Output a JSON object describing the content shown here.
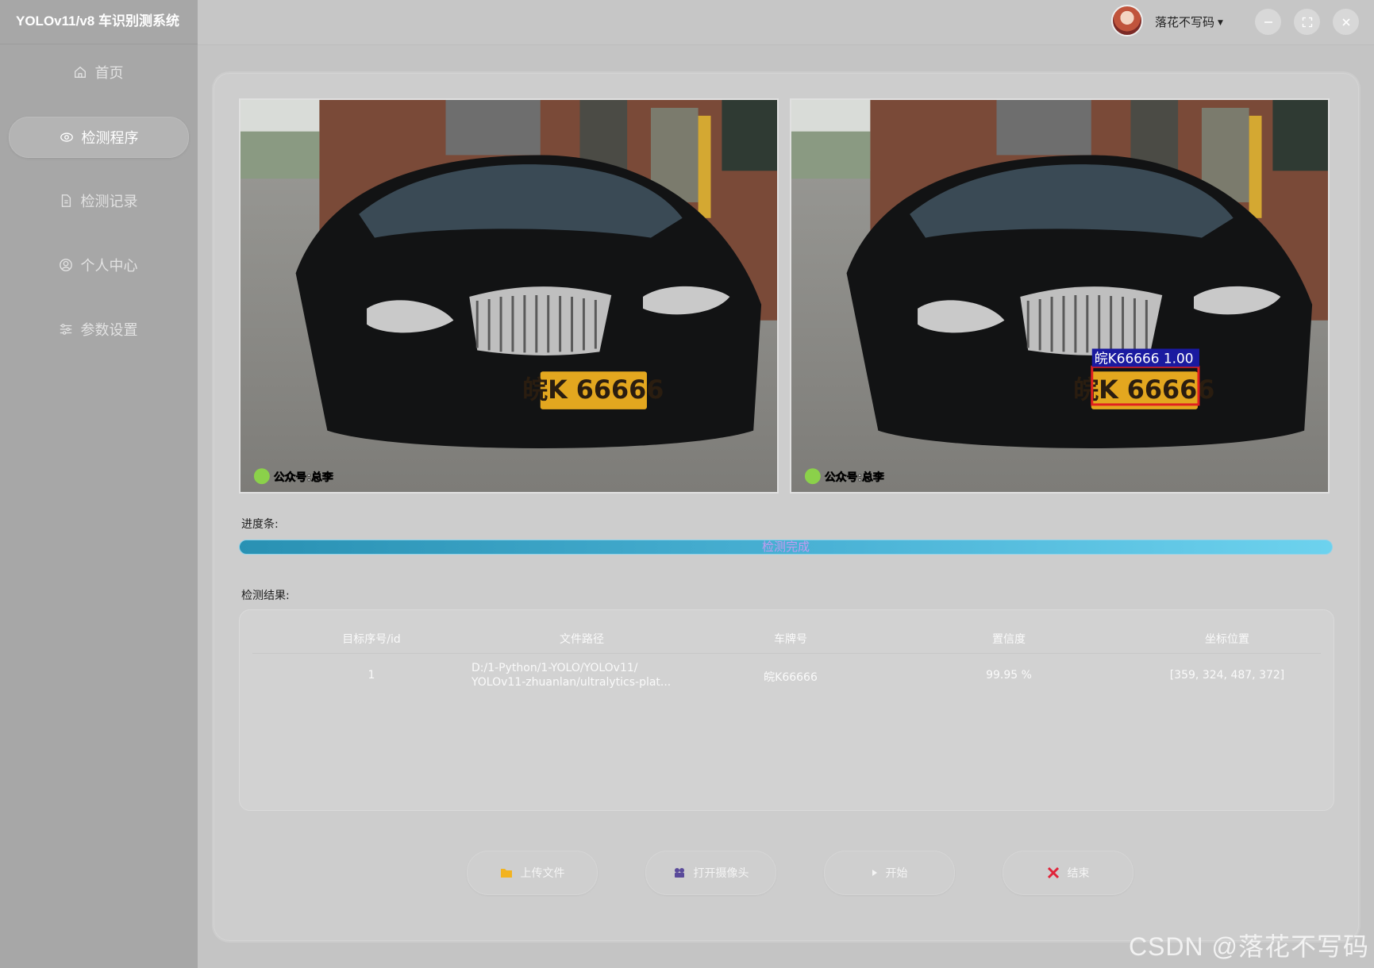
{
  "app": {
    "title": "YOLOv11/v8 车识别测系统"
  },
  "sidebar": {
    "items": [
      {
        "label": "首页",
        "icon": "home-icon",
        "active": false
      },
      {
        "label": "检测程序",
        "icon": "eye-icon",
        "active": true
      },
      {
        "label": "检测记录",
        "icon": "document-icon",
        "active": false
      },
      {
        "label": "个人中心",
        "icon": "user-icon",
        "active": false
      },
      {
        "label": "参数设置",
        "icon": "sliders-icon",
        "active": false
      }
    ]
  },
  "header": {
    "username": "落花不写码",
    "dropdown_icon": "caret-down-icon",
    "window_controls": [
      "minimize-icon",
      "maximize-icon",
      "close-icon"
    ]
  },
  "images": {
    "original": {
      "overlay_text": "公众号:总李"
    },
    "result": {
      "overlay_text": "公众号:总李",
      "detection_label": "皖K66666 1.00",
      "box_color": "#e02020",
      "label_bg": "#1a1aa0"
    }
  },
  "plate_text": "皖K 66666",
  "progress": {
    "label": "进度条:",
    "status_text": "检测完成",
    "fraction": 1.0
  },
  "results": {
    "label": "检测结果:",
    "columns": [
      "目标序号/id",
      "文件路径",
      "车牌号",
      "置信度",
      "坐标位置"
    ],
    "rows": [
      {
        "id": "1",
        "path_line1": "D:/1-Python/1-YOLO/YOLOv11/",
        "path_line2": "YOLOv11-zhuanlan/ultralytics-plat...",
        "plate": "皖K66666",
        "confidence": "99.95 %",
        "coords": "[359, 324, 487, 372]"
      }
    ]
  },
  "actions": {
    "upload": "上传文件",
    "camera": "打开摄像头",
    "start": "开始",
    "end": "结束"
  },
  "colors": {
    "sidebar_bg": "#a7a7a7",
    "progress_start": "#2991b3",
    "progress_end": "#6dd2ee",
    "end_icon": "#e0243a",
    "upload_icon": "#f2b320",
    "camera_icon": "#5a4a9a"
  },
  "watermark": "CSDN @落花不写码"
}
